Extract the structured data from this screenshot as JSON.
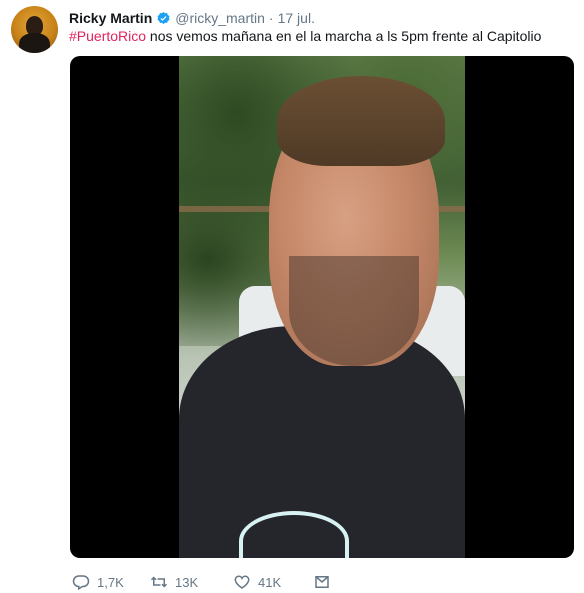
{
  "tweet": {
    "author_name": "Ricky Martin",
    "handle": "@ricky_martin",
    "separator": "·",
    "time": "17 jul.",
    "hashtag": "#PuertoRico",
    "text": " nos vemos mañana en el la marcha a ls 5pm frente al Capitolio"
  },
  "actions": {
    "reply_count": "1,7K",
    "retweet_count": "13K",
    "like_count": "41K"
  },
  "colors": {
    "hashtag": "#e0245e",
    "verified": "#1da1f2",
    "muted": "#657786"
  },
  "icons": [
    "avatar",
    "verified-badge-icon",
    "reply-icon",
    "retweet-icon",
    "like-icon",
    "message-icon"
  ]
}
